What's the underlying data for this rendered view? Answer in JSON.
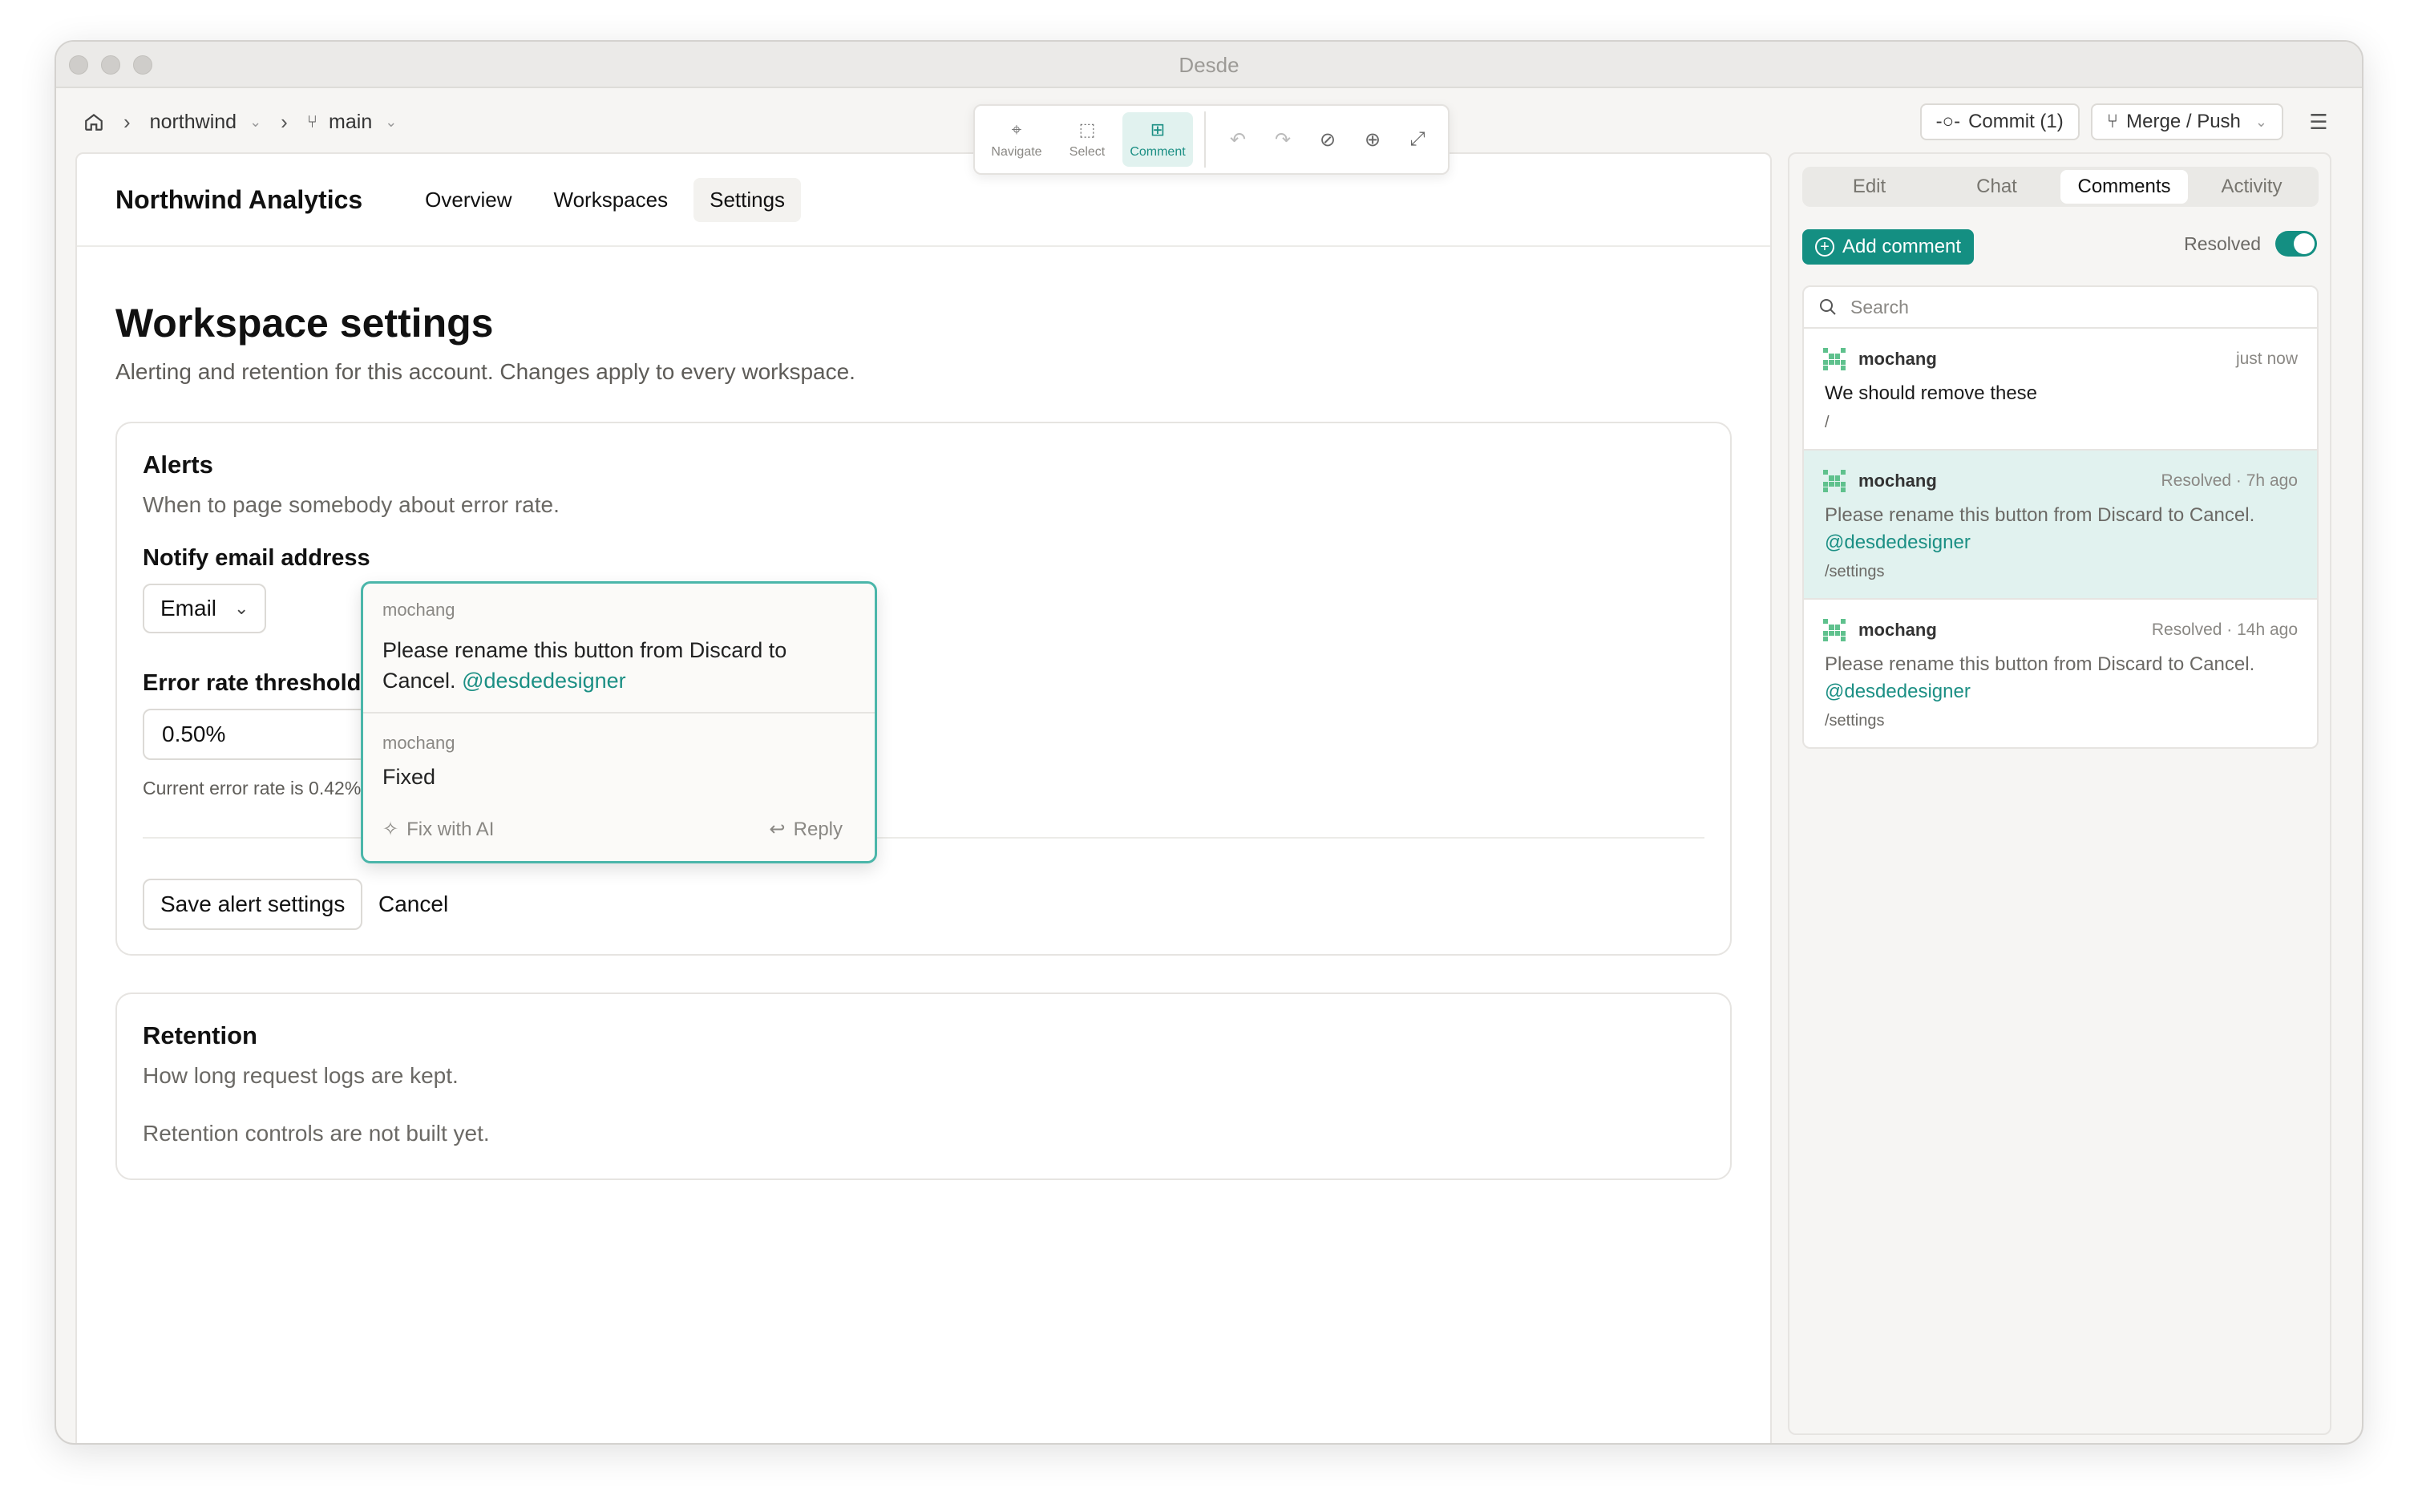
{
  "window": {
    "title": "Desde"
  },
  "breadcrumb": {
    "project": "northwind",
    "branch": "main"
  },
  "modes": [
    {
      "label": "Navigate",
      "icon": "cursor-sparkle-icon"
    },
    {
      "label": "Select",
      "icon": "select-box-icon"
    },
    {
      "label": "Comment",
      "icon": "comment-plus-icon",
      "active": true
    }
  ],
  "toolbar": {
    "commit_label": "Commit (1)",
    "merge_label": "Merge / Push"
  },
  "app": {
    "brand": "Northwind Analytics",
    "nav": [
      "Overview",
      "Workspaces",
      "Settings"
    ],
    "active_nav": "Settings"
  },
  "page": {
    "title": "Workspace settings",
    "subtitle": "Alerting and retention for this account. Changes apply to every workspace."
  },
  "alerts": {
    "title": "Alerts",
    "subtitle": "When to page somebody about error rate.",
    "notify_label": "Notify email address",
    "notify_value": "Email",
    "threshold_label": "Error rate threshold",
    "threshold_value": "0.50%",
    "hint": "Current error rate is 0.42%",
    "save_label": "Save alert settings",
    "cancel_label": "Cancel"
  },
  "retention": {
    "title": "Retention",
    "subtitle": "How long request logs are kept.",
    "note": "Retention controls are not built yet."
  },
  "popup": {
    "thread": [
      {
        "author": "mochang",
        "text": "Please rename this button from Discard to Cancel.",
        "mention": "@desdedesigner"
      },
      {
        "author": "mochang",
        "text": "Fixed"
      }
    ],
    "fix_label": "Fix with AI",
    "reply_label": "Reply"
  },
  "sidebar": {
    "tabs": [
      "Edit",
      "Chat",
      "Comments",
      "Activity"
    ],
    "active_tab": "Comments",
    "add_comment_label": "Add comment",
    "resolved_label": "Resolved",
    "resolved_toggle_on": true,
    "search_placeholder": "Search",
    "comments": [
      {
        "author": "mochang",
        "time": "just now",
        "text": "We should remove these",
        "path": "/"
      },
      {
        "author": "mochang",
        "time": "Resolved · 7h ago",
        "text": "Please rename this button from Discard to Cancel.",
        "mention": "@desdedesigner",
        "path": "/settings"
      },
      {
        "author": "mochang",
        "time": "Resolved · 14h ago",
        "text": "Please rename this button from Discard to Cancel.",
        "mention": "@desdedesigner",
        "path": "/settings"
      }
    ]
  },
  "colors": {
    "accent": "#148f82",
    "accent_light": "#e1f2ef",
    "popup_border": "#4bb6aa"
  }
}
